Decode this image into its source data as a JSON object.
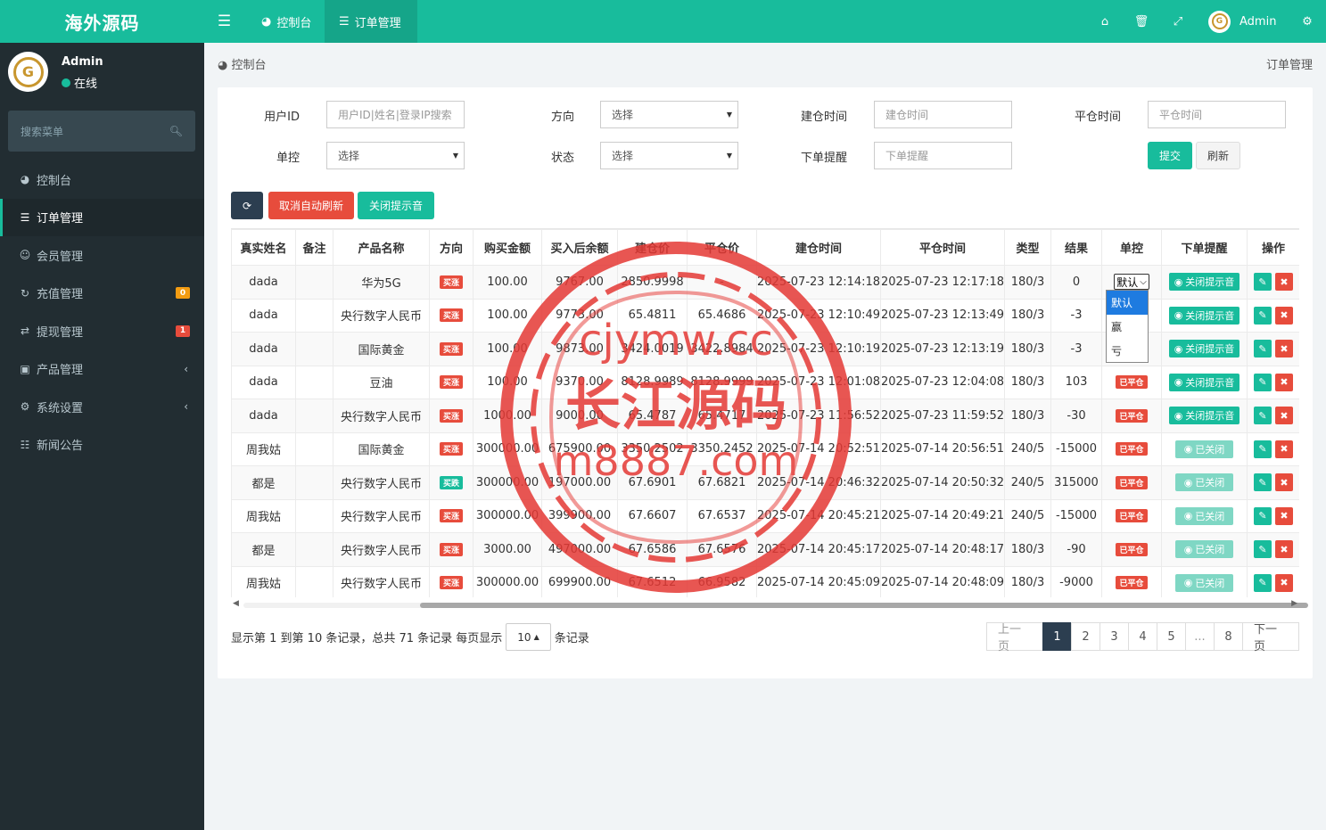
{
  "sidebar": {
    "logo": "海外源码",
    "user": {
      "name": "Admin",
      "status": "在线",
      "status_color": "#18bc9c"
    },
    "search_placeholder": "搜索菜单",
    "items": [
      {
        "label": "控制台",
        "icon": "dashboard-icon"
      },
      {
        "label": "订单管理",
        "icon": "list-icon",
        "active": true
      },
      {
        "label": "会员管理",
        "icon": "users-icon"
      },
      {
        "label": "充值管理",
        "icon": "recharge-icon",
        "badge": "0",
        "badge_color": "#f39c12"
      },
      {
        "label": "提现管理",
        "icon": "withdraw-icon",
        "badge": "1",
        "badge_color": "#e74c3c"
      },
      {
        "label": "产品管理",
        "icon": "shopping-bag-icon",
        "expandable": true
      },
      {
        "label": "系统设置",
        "icon": "cogs-icon",
        "expandable": true
      },
      {
        "label": "新闻公告",
        "icon": "newspaper-icon"
      }
    ]
  },
  "topbar": {
    "tabs": [
      {
        "label": "控制台",
        "icon": "dashboard-icon"
      },
      {
        "label": "订单管理",
        "icon": "list-icon",
        "active": true
      }
    ],
    "icons": [
      "home-icon",
      "trash-icon",
      "fullscreen-icon"
    ],
    "user_name": "Admin",
    "settings_icon": "cogs-icon"
  },
  "breadcrumb": {
    "left": "控制台",
    "right": "订单管理"
  },
  "filters": {
    "user_id": {
      "label": "用户ID",
      "placeholder": "用户ID|姓名|登录IP搜索"
    },
    "direction": {
      "label": "方向",
      "value": "选择"
    },
    "open_time": {
      "label": "建仓时间",
      "placeholder": "建仓时间"
    },
    "close_time": {
      "label": "平仓时间",
      "placeholder": "平仓时间"
    },
    "control": {
      "label": "单控",
      "value": "选择"
    },
    "status": {
      "label": "状态",
      "value": "选择"
    },
    "order_alert": {
      "label": "下单提醒",
      "placeholder": "下单提醒"
    },
    "submit": "提交",
    "reset": "刷新"
  },
  "toolbar": {
    "refresh_icon": "refresh-icon",
    "cancel_auto": "取消自动刷新",
    "close_sound": "关闭提示音"
  },
  "colors": {
    "primary": "#18bc9c",
    "danger": "#e74c3c",
    "dark": "#2c3e50",
    "warning": "#f39c12",
    "sidebar": "#222d32"
  },
  "table": {
    "headers": [
      "真实姓名",
      "备注",
      "产品名称",
      "方向",
      "购买金额",
      "买入后余额",
      "建仓价",
      "平仓价",
      "建仓时间",
      "平仓时间",
      "类型",
      "结果",
      "单控",
      "下单提醒",
      "操作"
    ],
    "rows": [
      {
        "name": "dada",
        "note": "",
        "product": "华为5G",
        "dir": "买涨",
        "amount": "100.00",
        "balance": "9767.00",
        "open": "2850.9998",
        "close": "-",
        "open_time": "2025-07-23 12:14:18",
        "close_time": "2025-07-23 12:17:18",
        "type": "180/3",
        "result": "0",
        "ctl": "select",
        "ctl_value": "默认",
        "notify": "关闭提示音"
      },
      {
        "name": "dada",
        "note": "",
        "product": "央行数字人民币",
        "dir": "买涨",
        "amount": "100.00",
        "balance": "9773.00",
        "open": "65.4811",
        "close": "65.4686",
        "open_time": "2025-07-23 12:10:49",
        "close_time": "2025-07-23 12:13:49",
        "type": "180/3",
        "result": "-3",
        "ctl": "",
        "notify": "关闭提示音"
      },
      {
        "name": "dada",
        "note": "",
        "product": "国际黄金",
        "dir": "买涨",
        "amount": "100.00",
        "balance": "9873.00",
        "open": "3424.0019",
        "close": "3422.8984",
        "open_time": "2025-07-23 12:10:19",
        "close_time": "2025-07-23 12:13:19",
        "type": "180/3",
        "result": "-3",
        "ctl": "",
        "notify": "关闭提示音"
      },
      {
        "name": "dada",
        "note": "",
        "product": "豆油",
        "dir": "买涨",
        "amount": "100.00",
        "balance": "9370.00",
        "open": "8128.9989",
        "close": "8128.9999",
        "open_time": "2025-07-23 12:01:08",
        "close_time": "2025-07-23 12:04:08",
        "type": "180/3",
        "result": "103",
        "ctl": "已平仓",
        "notify": "关闭提示音"
      },
      {
        "name": "dada",
        "note": "",
        "product": "央行数字人民币",
        "dir": "买涨",
        "amount": "1000.00",
        "balance": "9000.00",
        "open": "65.4787",
        "close": "65.4717",
        "open_time": "2025-07-23 11:56:52",
        "close_time": "2025-07-23 11:59:52",
        "type": "180/3",
        "result": "-30",
        "ctl": "已平仓",
        "notify": "关闭提示音"
      },
      {
        "name": "周我姑",
        "note": "",
        "product": "国际黄金",
        "dir": "买涨",
        "amount": "300000.00",
        "balance": "675900.00",
        "open": "3350.2502",
        "close": "3350.2452",
        "open_time": "2025-07-14 20:52:51",
        "close_time": "2025-07-14 20:56:51",
        "type": "240/5",
        "result": "-15000",
        "ctl": "已平仓",
        "notify": "已关闭"
      },
      {
        "name": "都是",
        "note": "",
        "product": "央行数字人民币",
        "dir": "买跌",
        "amount": "300000.00",
        "balance": "197000.00",
        "open": "67.6901",
        "close": "67.6821",
        "open_time": "2025-07-14 20:46:32",
        "close_time": "2025-07-14 20:50:32",
        "type": "240/5",
        "result": "315000",
        "ctl": "已平仓",
        "notify": "已关闭"
      },
      {
        "name": "周我姑",
        "note": "",
        "product": "央行数字人民币",
        "dir": "买涨",
        "amount": "300000.00",
        "balance": "399900.00",
        "open": "67.6607",
        "close": "67.6537",
        "open_time": "2025-07-14 20:45:21",
        "close_time": "2025-07-14 20:49:21",
        "type": "240/5",
        "result": "-15000",
        "ctl": "已平仓",
        "notify": "已关闭"
      },
      {
        "name": "都是",
        "note": "",
        "product": "央行数字人民币",
        "dir": "买涨",
        "amount": "3000.00",
        "balance": "497000.00",
        "open": "67.6586",
        "close": "67.6576",
        "open_time": "2025-07-14 20:45:17",
        "close_time": "2025-07-14 20:48:17",
        "type": "180/3",
        "result": "-90",
        "ctl": "已平仓",
        "notify": "已关闭"
      },
      {
        "name": "周我姑",
        "note": "",
        "product": "央行数字人民币",
        "dir": "买涨",
        "amount": "300000.00",
        "balance": "699900.00",
        "open": "67.6512",
        "close": "66.9582",
        "open_time": "2025-07-14 20:45:09",
        "close_time": "2025-07-14 20:48:09",
        "type": "180/3",
        "result": "-9000",
        "ctl": "已平仓",
        "notify": "已关闭"
      }
    ]
  },
  "control_dropdown": {
    "options": [
      "默认",
      "赢",
      "亏"
    ],
    "selected": "默认"
  },
  "footer": {
    "info": "显示第 1 到第 10 条记录，总共 71 条记录 每页显示",
    "page_size": "10",
    "suffix": "条记录"
  },
  "pager": [
    "上一页",
    "1",
    "2",
    "3",
    "4",
    "5",
    "...",
    "8",
    "下一页"
  ],
  "watermark": {
    "line1": "cjymw.cc",
    "line2": "长江源码",
    "line3": "m8887.com"
  }
}
